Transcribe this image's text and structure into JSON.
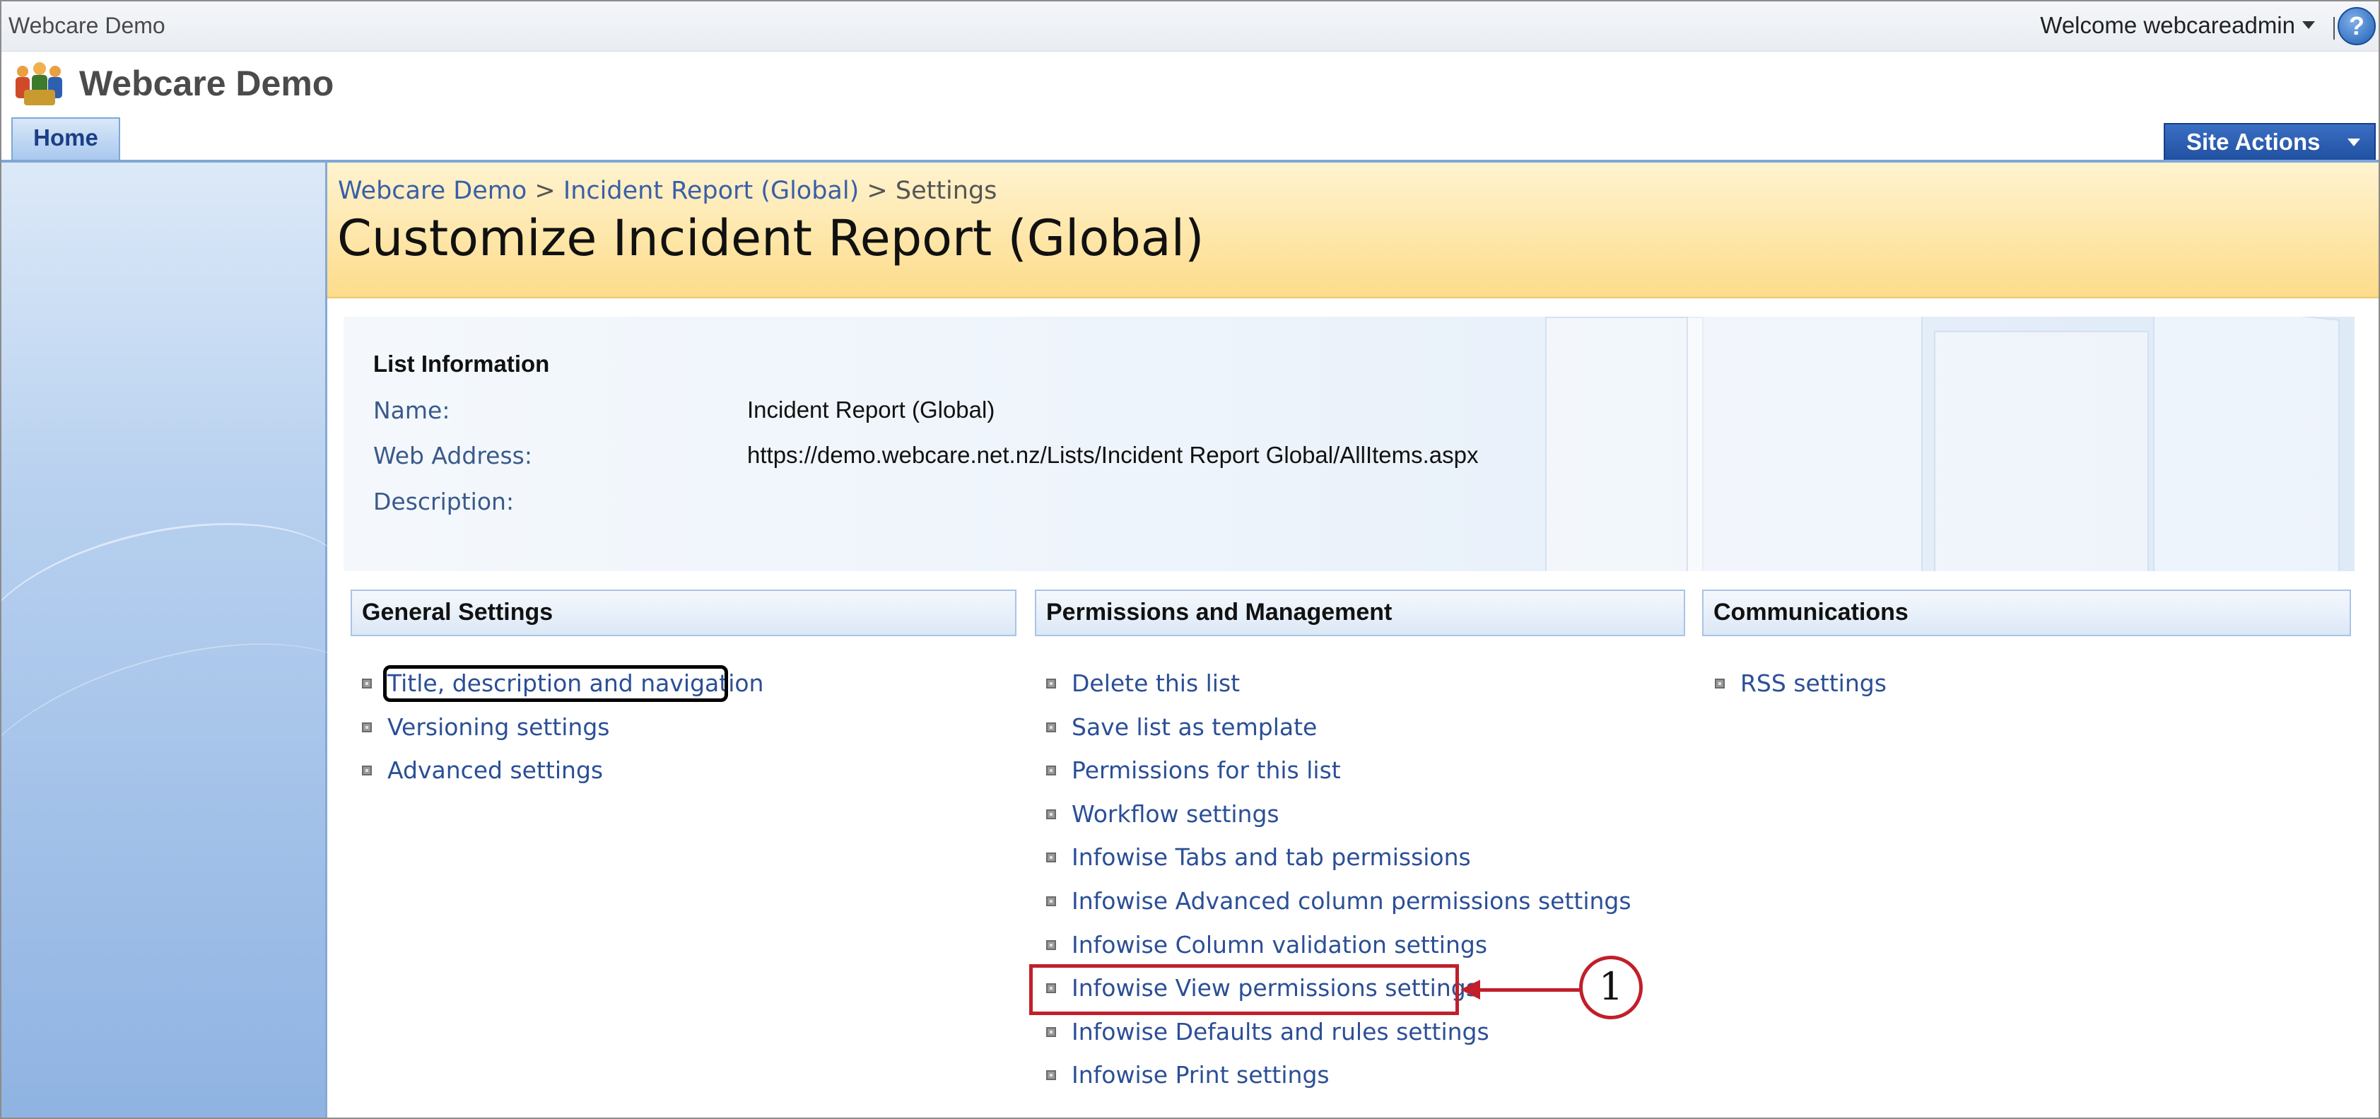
{
  "topbar": {
    "site_name": "Webcare Demo",
    "welcome": "Welcome webcareadmin",
    "help_icon": "?"
  },
  "header": {
    "title": "Webcare Demo",
    "logo_icon": "people-group-icon"
  },
  "nav": {
    "home_tab": "Home",
    "site_actions": "Site Actions"
  },
  "breadcrumb": {
    "items": [
      "Webcare Demo",
      "Incident Report (Global)",
      "Settings"
    ],
    "separator": ">"
  },
  "page_title": "Customize Incident Report (Global)",
  "list_info": {
    "heading": "List Information",
    "name_label": "Name:",
    "name_value": "Incident Report (Global)",
    "web_address_label": "Web Address:",
    "web_address_value": "https://demo.webcare.net.nz/Lists/Incident Report Global/AllItems.aspx",
    "description_label": "Description:",
    "description_value": ""
  },
  "sections": {
    "general": {
      "heading": "General Settings",
      "links": [
        "Title, description and navigation",
        "Versioning settings",
        "Advanced settings"
      ]
    },
    "permissions": {
      "heading": "Permissions and Management",
      "links": [
        "Delete this list",
        "Save list as template",
        "Permissions for this list",
        "Workflow settings",
        "Infowise Tabs and tab permissions",
        "Infowise Advanced column permissions settings",
        "Infowise Column validation settings",
        "Infowise View permissions settings",
        "Infowise Defaults and rules settings",
        "Infowise Print settings"
      ]
    },
    "communications": {
      "heading": "Communications",
      "links": [
        "RSS settings"
      ]
    }
  },
  "callout": {
    "number": "1",
    "color": "#c0202a"
  },
  "colors": {
    "link": "#2b4f96",
    "title_band": "#fddc8a",
    "site_actions": "#1f4f9f"
  }
}
